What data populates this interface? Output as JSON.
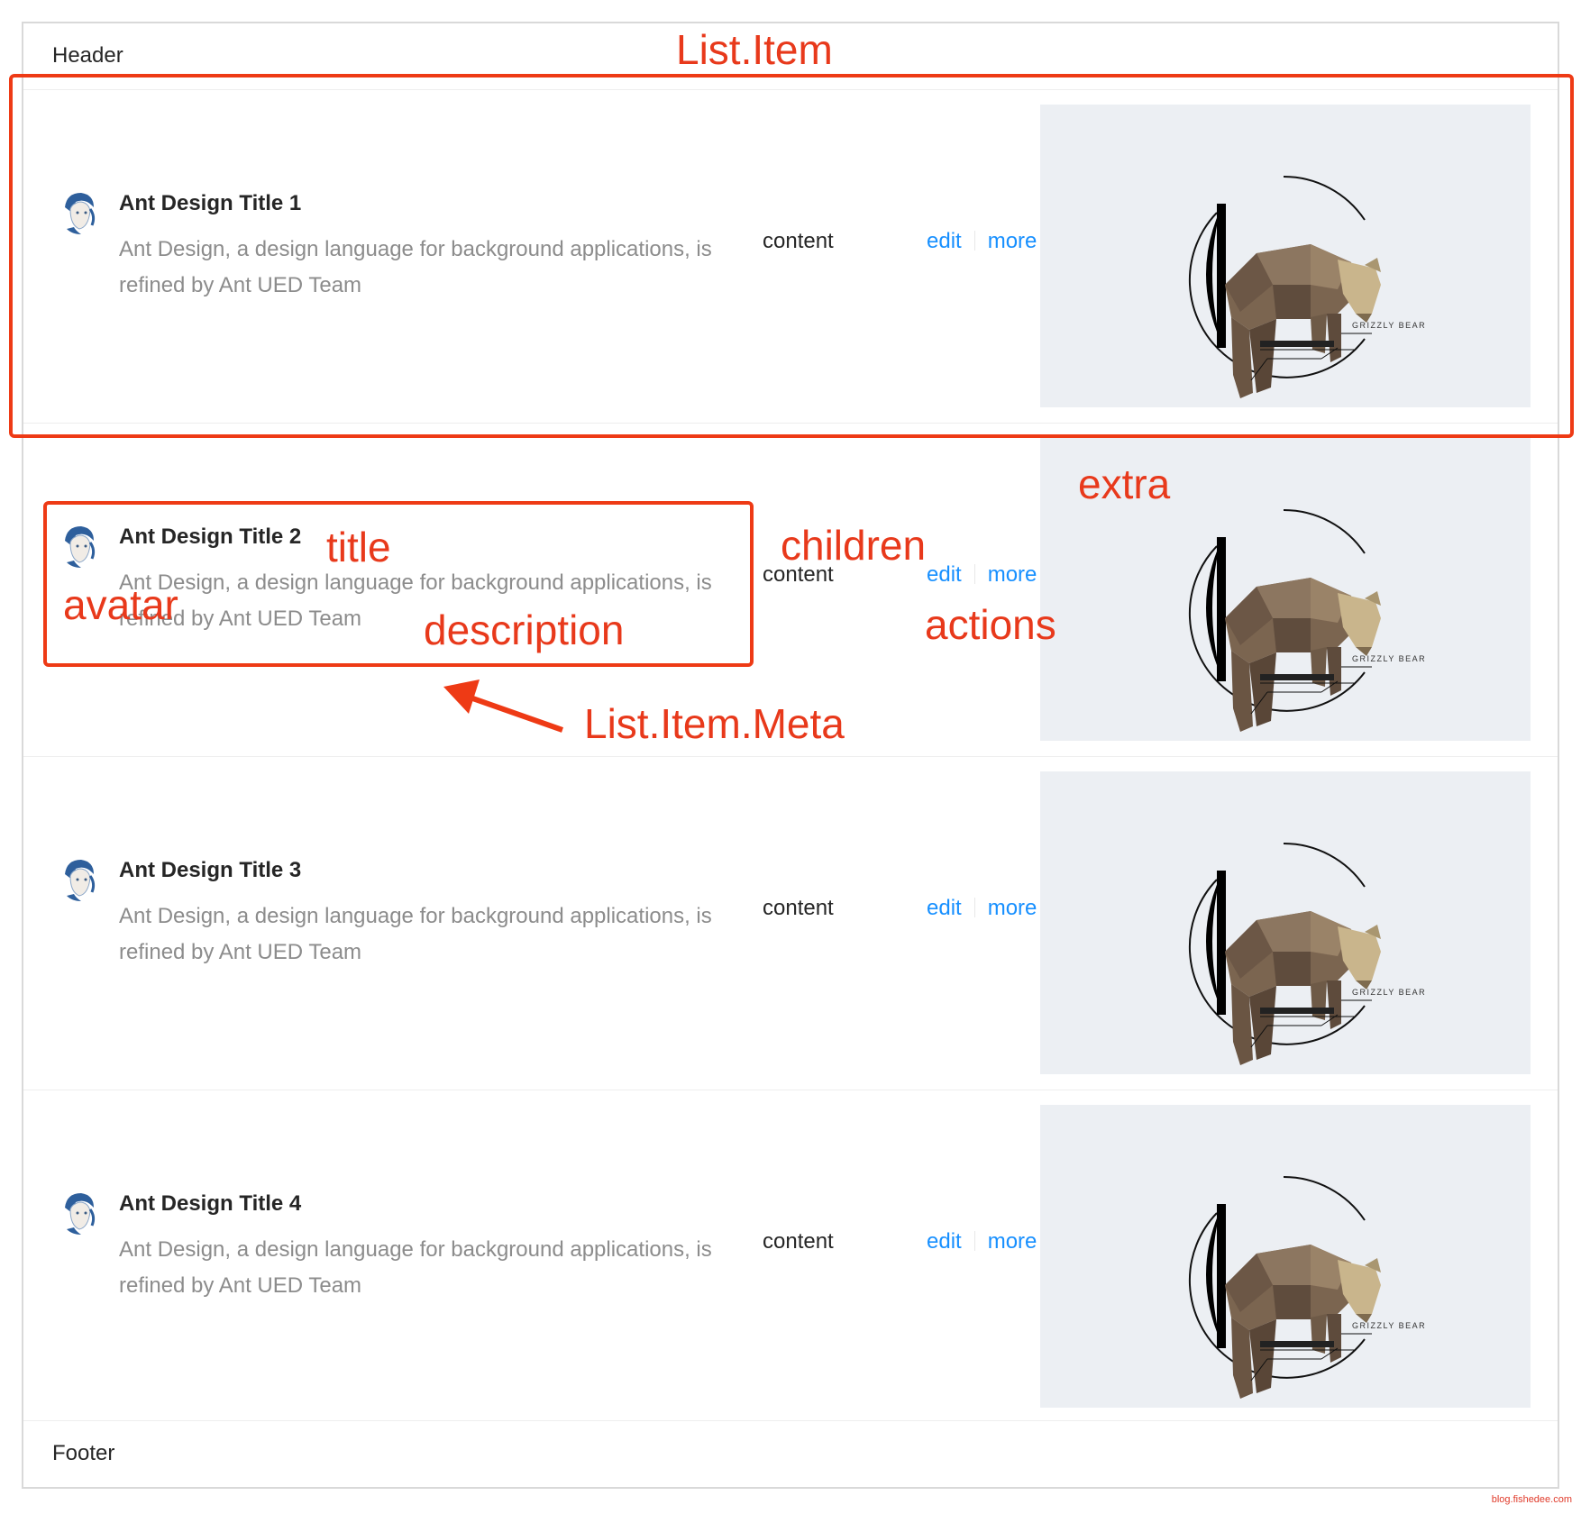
{
  "list": {
    "header": "Header",
    "footer": "Footer",
    "items": [
      {
        "title": "Ant Design Title 1",
        "description": "Ant Design, a design language for background applications, is refined by Ant UED Team",
        "content": "content",
        "actions": [
          "edit",
          "more"
        ],
        "extra_label": "GRIZZLY BEAR"
      },
      {
        "title": "Ant Design Title 2",
        "description": "Ant Design, a design language for background applications, is refined by Ant UED Team",
        "content": "content",
        "actions": [
          "edit",
          "more"
        ],
        "extra_label": "GRIZZLY BEAR"
      },
      {
        "title": "Ant Design Title 3",
        "description": "Ant Design, a design language for background applications, is refined by Ant UED Team",
        "content": "content",
        "actions": [
          "edit",
          "more"
        ],
        "extra_label": "GRIZZLY BEAR"
      },
      {
        "title": "Ant Design Title 4",
        "description": "Ant Design, a design language for background applications, is refined by Ant UED Team",
        "content": "content",
        "actions": [
          "edit",
          "more"
        ],
        "extra_label": "GRIZZLY BEAR"
      }
    ]
  },
  "annotations": {
    "list_item": "List.Item",
    "extra": "extra",
    "title": "title",
    "children": "children",
    "avatar": "avatar",
    "actions": "actions",
    "description": "description",
    "list_item_meta": "List.Item.Meta"
  },
  "watermark": "blog.fishedee.com",
  "colors": {
    "annotation": "#e8391b",
    "link": "#1890ff",
    "extra_bg": "#eceff3"
  }
}
